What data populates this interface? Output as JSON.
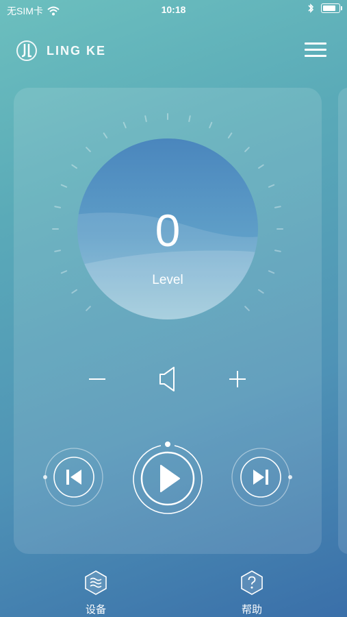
{
  "status": {
    "carrier": "无SIM卡",
    "time": "10:18",
    "icons": [
      "wifi-icon",
      "bluetooth-icon",
      "battery-icon"
    ]
  },
  "header": {
    "brand": "LING KE",
    "logo": "jl-logo-icon",
    "menu_icon": "hamburger-menu-icon"
  },
  "player": {
    "level_value": "0",
    "level_label": "Level",
    "volume_icons": [
      "minus-icon",
      "speaker-icon",
      "plus-icon"
    ],
    "controls": [
      "previous-icon",
      "play-icon",
      "next-icon"
    ]
  },
  "tabs": [
    {
      "label": "设备",
      "icon": "waves-hexagon-icon"
    },
    {
      "label": "帮助",
      "icon": "question-hexagon-icon"
    }
  ],
  "colors": {
    "background_start": "#6cbfbe",
    "background_end": "#3a6fa9",
    "accent": "#ffffff"
  }
}
